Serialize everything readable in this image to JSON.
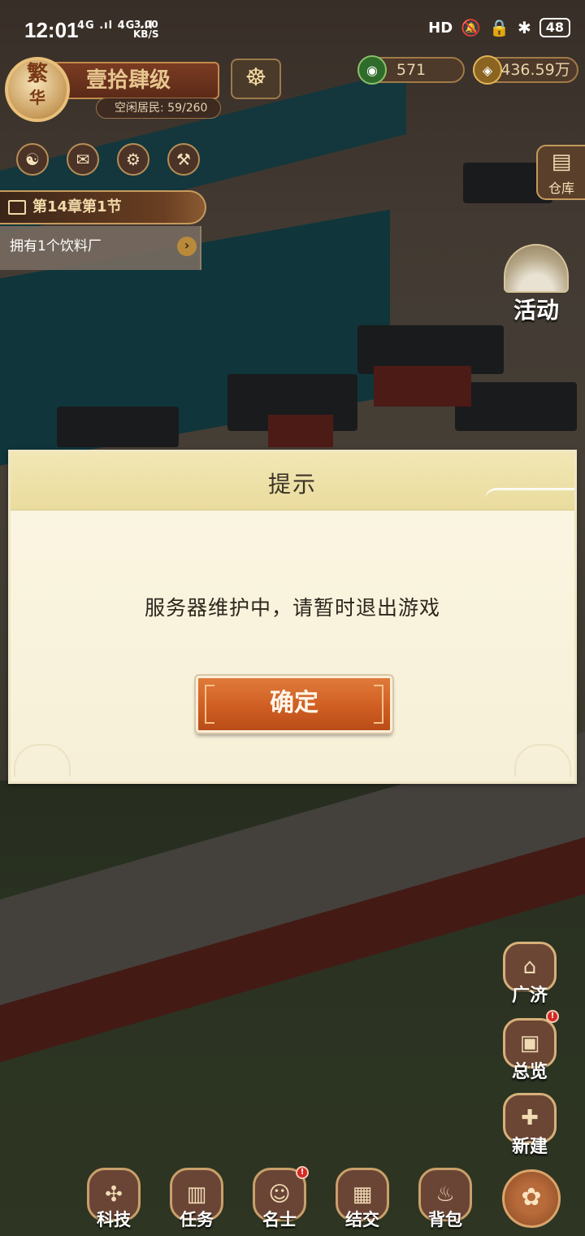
{
  "status_bar": {
    "time": "12:01",
    "signal_text": "4G .ıl 4G .ıl",
    "speed_value": "3.00",
    "speed_unit": "KB/S",
    "hd_label": "HD",
    "battery": "48"
  },
  "hud": {
    "avatar_line1": "繁",
    "avatar_line2": "华",
    "level": "壹拾肆级",
    "idle_residents_label": "空闲居民:",
    "idle_residents_value": "59/260",
    "chapter": "第14章第1节",
    "task": "拥有1个饮料厂",
    "copper_coins": "571",
    "gold": "436.59万",
    "warehouse": "仓库",
    "activity": "活动"
  },
  "side_buttons": [
    {
      "label": "广济",
      "icon": "granary-icon"
    },
    {
      "label": "总览",
      "icon": "scroll-overview-icon",
      "badge": true
    },
    {
      "label": "新建",
      "icon": "build-house-icon"
    }
  ],
  "bottom_nav": [
    {
      "label": "科技",
      "icon": "tech-tree-icon"
    },
    {
      "label": "任务",
      "icon": "scroll-icon"
    },
    {
      "label": "名士",
      "icon": "scholar-icon",
      "badge": true
    },
    {
      "label": "结交",
      "icon": "cards-icon"
    },
    {
      "label": "背包",
      "icon": "bag-icon"
    }
  ],
  "dialog": {
    "title": "提示",
    "message": "服务器维护中，请暂时退出游戏",
    "confirm_label": "确定"
  },
  "colors": {
    "dialog_bg": "#f7f0d8",
    "dialog_header": "#eadc9e",
    "confirm_button": "#cf5e22",
    "overlay_dim": "rgba(0,0,0,0.38)"
  }
}
